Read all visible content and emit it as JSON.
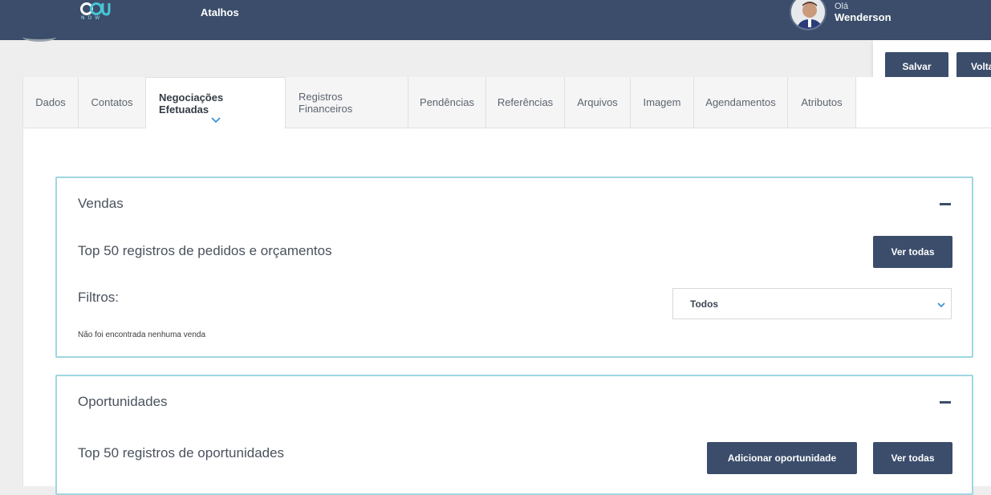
{
  "header": {
    "logo_text": "NOW",
    "shortcuts_label": "Atalhos",
    "greeting": "Olá",
    "username": "Wenderson"
  },
  "actions": {
    "save_label": "Salvar",
    "back_label": "Voltar"
  },
  "tabs": [
    {
      "label": "Dados",
      "active": false
    },
    {
      "label": "Contatos",
      "active": false
    },
    {
      "label": "Negociações Efetuadas",
      "active": true
    },
    {
      "label": "Registros Financeiros",
      "active": false
    },
    {
      "label": "Pendências",
      "active": false
    },
    {
      "label": "Referências",
      "active": false
    },
    {
      "label": "Arquivos",
      "active": false
    },
    {
      "label": "Imagem",
      "active": false
    },
    {
      "label": "Agendamentos",
      "active": false
    },
    {
      "label": "Atributos",
      "active": false
    }
  ],
  "vendas": {
    "title": "Vendas",
    "subtitle": "Top 50 registros de pedidos e orçamentos",
    "see_all_label": "Ver todas",
    "filters_label": "Filtros:",
    "filter_selected": "Todos",
    "empty_message": "Não foi encontrada nenhuma venda"
  },
  "oportunidades": {
    "title": "Oportunidades",
    "subtitle": "Top 50 registros de oportunidades",
    "add_label": "Adicionar oportunidade",
    "see_all_label": "Ver todas"
  },
  "colors": {
    "primary": "#3b4d6b",
    "panel_border": "#9ed7e0",
    "accent_chevron": "#2f8fd0"
  }
}
